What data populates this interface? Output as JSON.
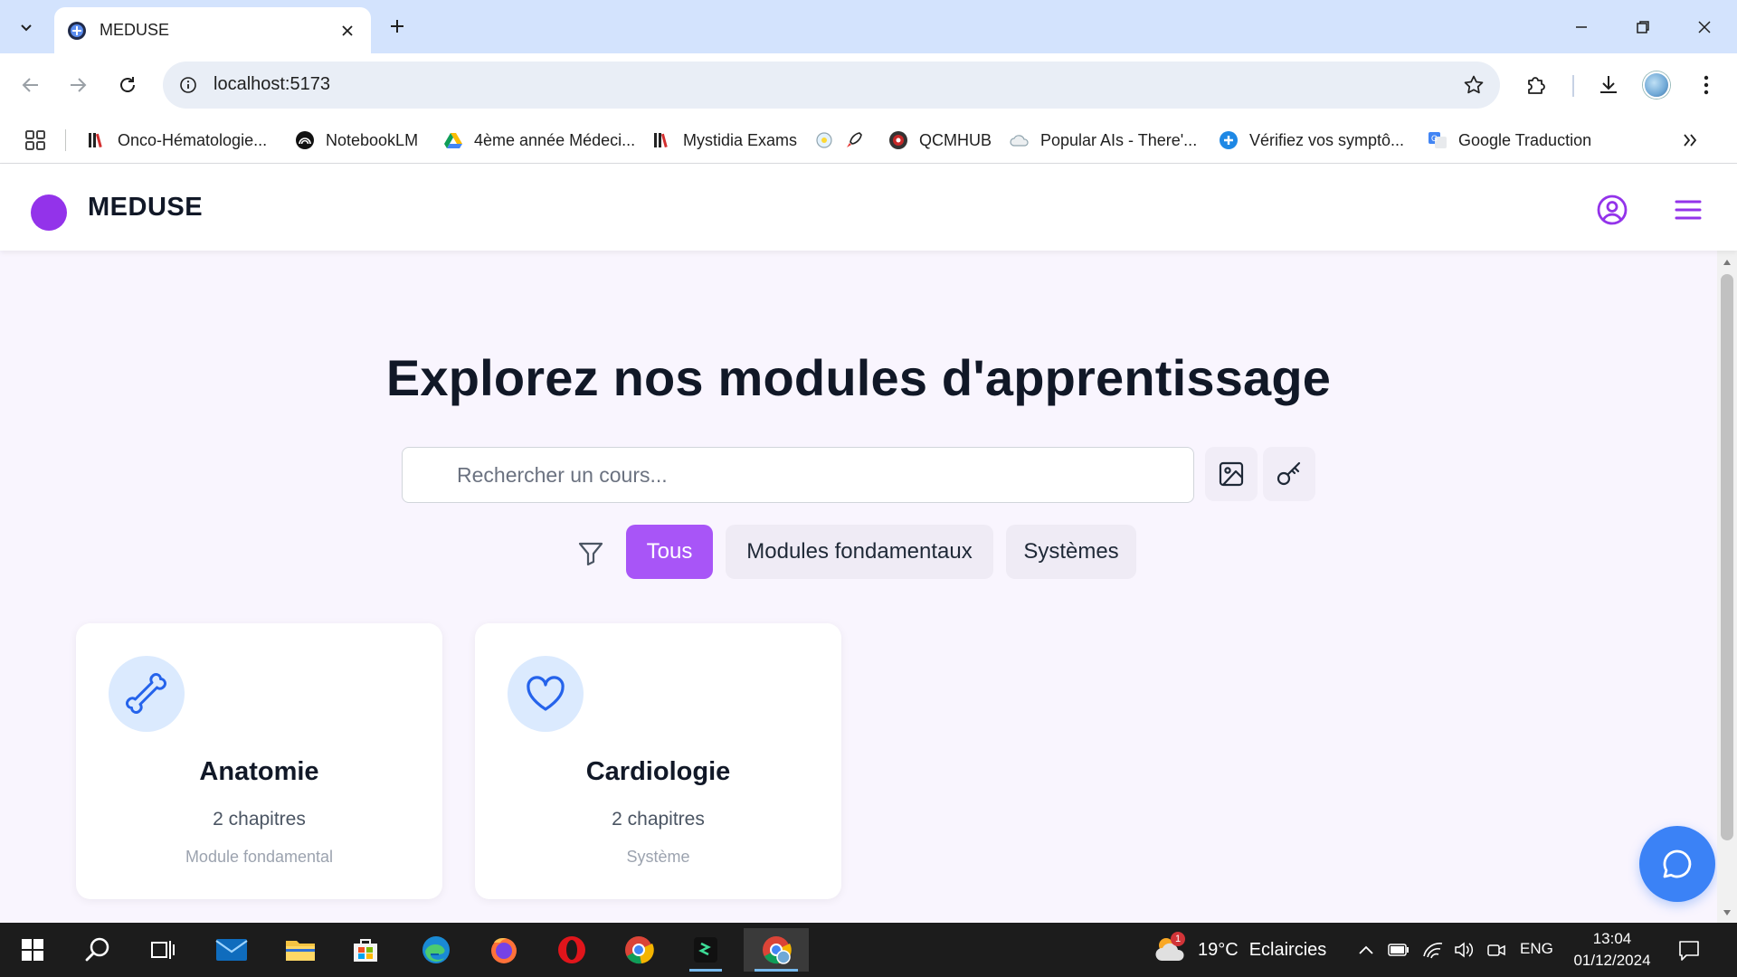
{
  "browser": {
    "tab_title": "MEDUSE",
    "url": "localhost:5173",
    "bookmarks": [
      {
        "label": "Onco-Hématologie...",
        "icon": "library-icon"
      },
      {
        "label": "NotebookLM",
        "icon": "notebooklm-icon"
      },
      {
        "label": "4ème année Médeci...",
        "icon": "google-drive-icon"
      },
      {
        "label": "Mystidia Exams",
        "icon": "library-icon"
      },
      {
        "label": "",
        "icon": "globe-icon"
      },
      {
        "label": "",
        "icon": "rocket-icon"
      },
      {
        "label": "QCMHUB",
        "icon": "qcmhub-icon"
      },
      {
        "label": "Popular AIs - There'...",
        "icon": "cloud-icon"
      },
      {
        "label": "Vérifiez vos symptô...",
        "icon": "plus-circle-icon"
      },
      {
        "label": "Google Traduction",
        "icon": "google-translate-icon"
      }
    ]
  },
  "app": {
    "brand": "MEDUSE",
    "brand_color": "#9333ea",
    "accent_color": "#a855f7"
  },
  "main": {
    "title": "Explorez nos modules d'apprentissage",
    "search_placeholder": "Rechercher un cours...",
    "filters": [
      {
        "label": "Tous",
        "active": true
      },
      {
        "label": "Modules fondamentaux",
        "active": false
      },
      {
        "label": "Systèmes",
        "active": false
      }
    ],
    "cards": [
      {
        "title": "Anatomie",
        "count": "2 chapitres",
        "type": "Module fondamental",
        "icon": "bone-icon"
      },
      {
        "title": "Cardiologie",
        "count": "2 chapitres",
        "type": "Système",
        "icon": "heart-icon"
      }
    ]
  },
  "taskbar": {
    "weather_temp": "19°C",
    "weather_text": "Eclaircies",
    "weather_badge": "1",
    "language": "ENG",
    "time": "13:04",
    "date": "01/12/2024"
  }
}
